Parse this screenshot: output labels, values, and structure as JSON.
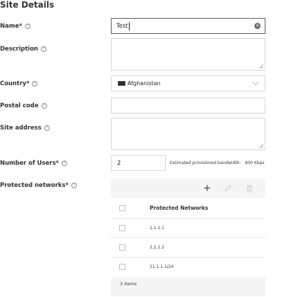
{
  "page_title": "Site Details",
  "fields": {
    "name": {
      "label": "Name*",
      "value": "Test"
    },
    "description": {
      "label": "Description",
      "value": ""
    },
    "country": {
      "label": "Country*",
      "value": "Afghanistan"
    },
    "postal_code": {
      "label": "Postal code",
      "value": ""
    },
    "site_address": {
      "label": "Site address",
      "value": ""
    },
    "number_of_users": {
      "label": "Number of Users*",
      "value": "2"
    },
    "bandwidth": {
      "label": "Estimated provisioned bandwidth:",
      "value": "800 Kbps"
    },
    "protected_networks": {
      "label": "Protected networks*"
    }
  },
  "icons": {
    "help": "help-circle-icon",
    "clear": "clear-circle-icon",
    "add": "plus-icon",
    "edit": "pencil-icon",
    "delete": "trash-icon",
    "chevron": "chevron-down-icon",
    "flag": "afghanistan-flag-icon"
  },
  "networks_table": {
    "header": "Protected Networks",
    "rows": [
      "1.1.1.1",
      "2.2.2.2",
      "11.1.1.1/24"
    ],
    "footer": "3 items"
  },
  "colors": {
    "focus_border": "#5c5c5c",
    "panel_bg": "#f5f5f5",
    "border": "#d6d6d6"
  }
}
